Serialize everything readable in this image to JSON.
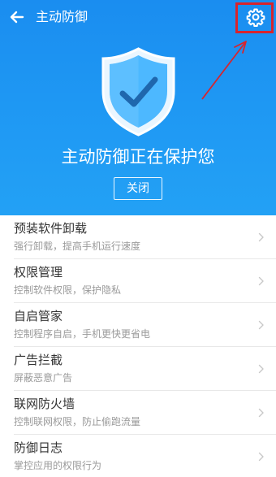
{
  "header": {
    "title": "主动防御",
    "back_icon": "arrow-left-icon",
    "settings_icon": "gear-icon"
  },
  "hero": {
    "shield_icon": "shield-check-icon",
    "status": "主动防御正在保护您",
    "close_label": "关闭"
  },
  "items": [
    {
      "title": "预装软件卸载",
      "desc": "强行卸载，提高手机运行速度"
    },
    {
      "title": "权限管理",
      "desc": "控制软件权限，保护隐私"
    },
    {
      "title": "自启管家",
      "desc": "控制程序自启，手机更快更省电"
    },
    {
      "title": "广告拦截",
      "desc": "屏蔽恶意广告"
    },
    {
      "title": "联网防火墙",
      "desc": "控制联网权限，防止偷跑流量"
    },
    {
      "title": "防御日志",
      "desc": "掌控应用的权限行为"
    }
  ],
  "colors": {
    "brand_blue": "#1e97f3",
    "annotation_red": "#d8242d"
  }
}
